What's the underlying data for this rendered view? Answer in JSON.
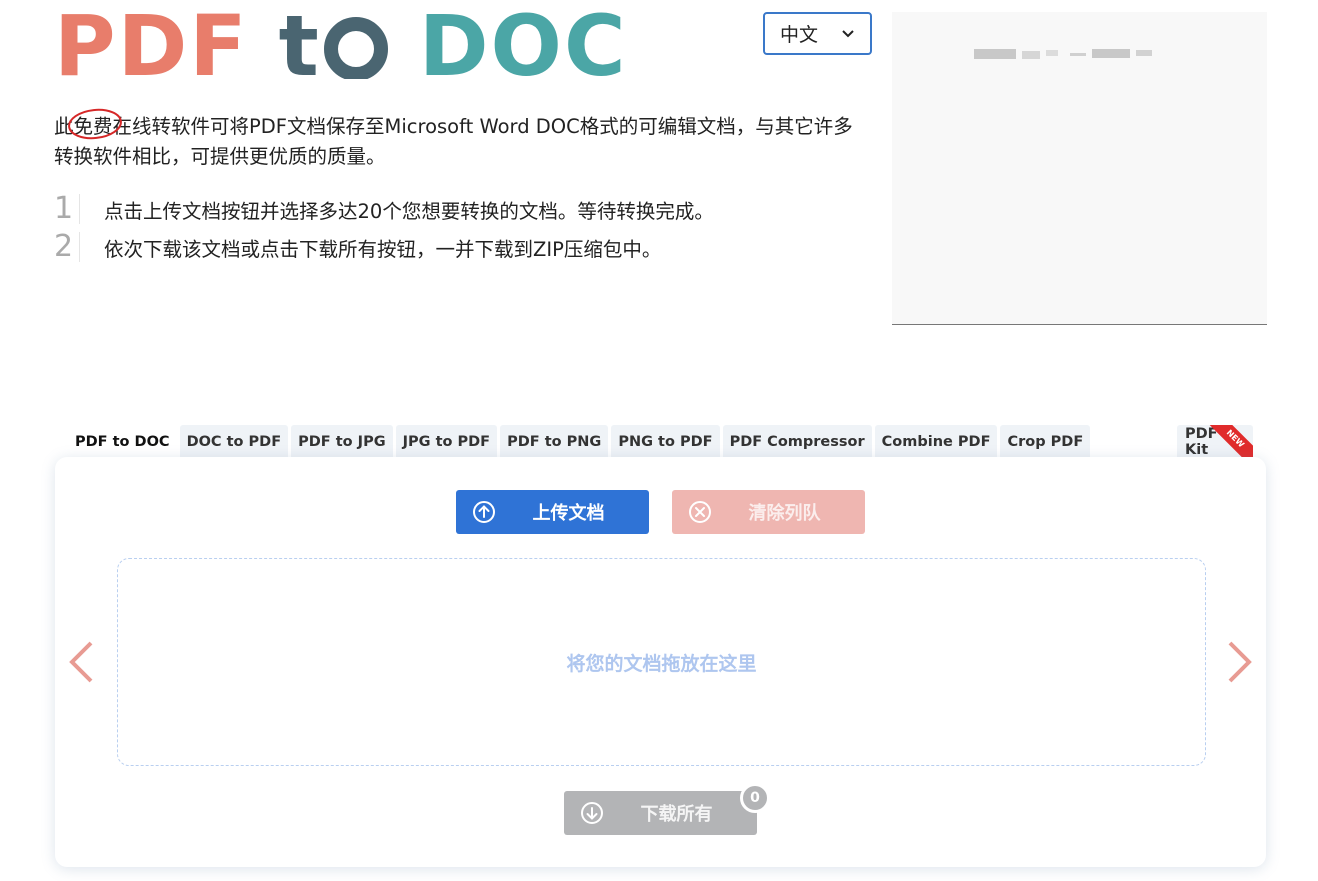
{
  "logo": {
    "part1": "PDF",
    "part2": "t",
    "part3": "DOC",
    "colors": {
      "pdf": "#e87d6b",
      "to": "#4a6571",
      "doc": "#4ba6a6"
    }
  },
  "language": {
    "selected": "中文"
  },
  "intro": {
    "before": "此",
    "highlight": "免费",
    "after": "在线转软件可将PDF文档保存至Microsoft Word DOC格式的可编辑文档，与其它许多转换软件相比，可提供更优质的质量。"
  },
  "steps": [
    {
      "num": "1",
      "text": "点击上传文档按钮并选择多达20个您想要转换的文档。等待转换完成。"
    },
    {
      "num": "2",
      "text": "依次下载该文档或点击下载所有按钮，一并下载到ZIP压缩包中。"
    }
  ],
  "tabs": [
    {
      "label": "PDF to DOC",
      "active": true
    },
    {
      "label": "DOC to PDF"
    },
    {
      "label": "PDF to JPG"
    },
    {
      "label": "JPG to PDF"
    },
    {
      "label": "PDF to PNG"
    },
    {
      "label": "PNG to PDF"
    },
    {
      "label": "PDF Compressor"
    },
    {
      "label": "Combine PDF"
    },
    {
      "label": "Crop PDF"
    }
  ],
  "tab_kit": {
    "label": "PDF Kit",
    "ribbon": "NEW"
  },
  "buttons": {
    "upload": "上传文档",
    "clear": "清除列队",
    "download_all": "下载所有"
  },
  "dropzone": {
    "text": "将您的文档拖放在这里"
  },
  "download_count": "0",
  "colors": {
    "primary": "#2f73d6",
    "clear": "#efb6b1",
    "disabled": "#b3b4b6",
    "arrow": "#e89b93"
  }
}
